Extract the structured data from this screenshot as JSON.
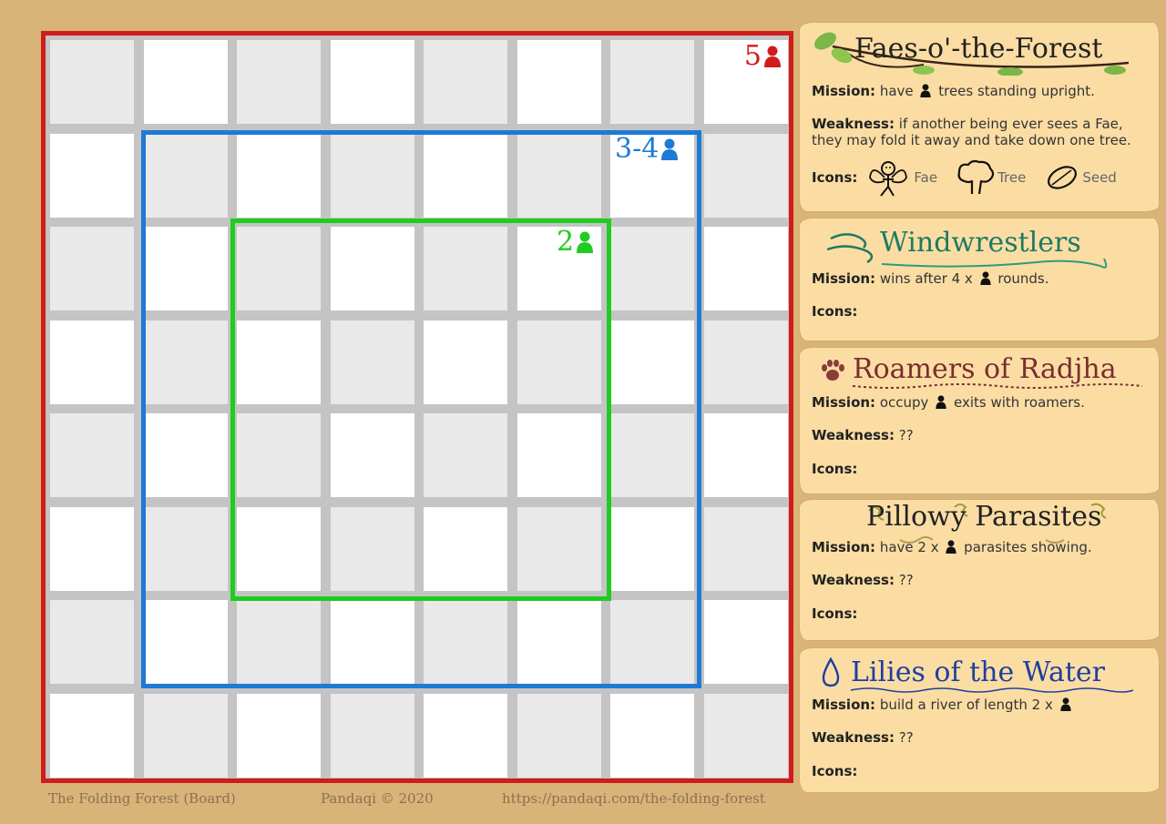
{
  "board": {
    "size": 8,
    "colors": {
      "outer": "#d11c1c",
      "medium": "#1d7ad6",
      "small": "#1fcc1f",
      "light_cell": "#ffffff",
      "dark_cell": "#e9e9e9",
      "grid_line": "#c4c4c4"
    },
    "labels": {
      "players_5": "5",
      "players_3_4": "3-4",
      "players_2": "2"
    }
  },
  "footer": {
    "title": "The Folding Forest (Board)",
    "copyright": "Pandaqi © 2020",
    "url": "https://pandaqi.com/the-folding-forest"
  },
  "cards": {
    "fae": {
      "title": "Faes-o'-the-Forest",
      "title_color": "#222222",
      "mission_label": "Mission:",
      "mission_pre": "have",
      "mission_post": "trees standing upright.",
      "weakness_label": "Weakness:",
      "weakness_line1": "if another being ever sees a Fae,",
      "weakness_line2": "they may fold it away and take down one tree.",
      "icons_label": "Icons:",
      "icons": [
        {
          "name": "fae-icon",
          "label": "Fae"
        },
        {
          "name": "tree-icon",
          "label": "Tree"
        },
        {
          "name": "seed-icon",
          "label": "Seed"
        }
      ]
    },
    "wind": {
      "title": "Windwrestlers",
      "title_color": "#1e7a62",
      "mission_label": "Mission:",
      "mission_pre": "wins after 4 x",
      "mission_post": "rounds.",
      "icons_label": "Icons:"
    },
    "roam": {
      "title": "Roamers of Radjha",
      "title_color": "#7a2e2e",
      "mission_label": "Mission:",
      "mission_pre": "occupy",
      "mission_post": "exits with roamers.",
      "weakness_label": "Weakness:",
      "weakness_text": "??",
      "icons_label": "Icons:"
    },
    "pillow": {
      "title": "Pillowy Parasites",
      "title_color": "#222222",
      "mission_label": "Mission:",
      "mission_pre": "have 2 x",
      "mission_post": "parasites showing.",
      "weakness_label": "Weakness:",
      "weakness_text": "??",
      "icons_label": "Icons:"
    },
    "lily": {
      "title": "Lilies of the Water",
      "title_color": "#1e3f9e",
      "mission_label": "Mission:",
      "mission_pre": "build a river of length 2 x",
      "weakness_label": "Weakness:",
      "weakness_text": "??",
      "icons_label": "Icons:"
    }
  }
}
